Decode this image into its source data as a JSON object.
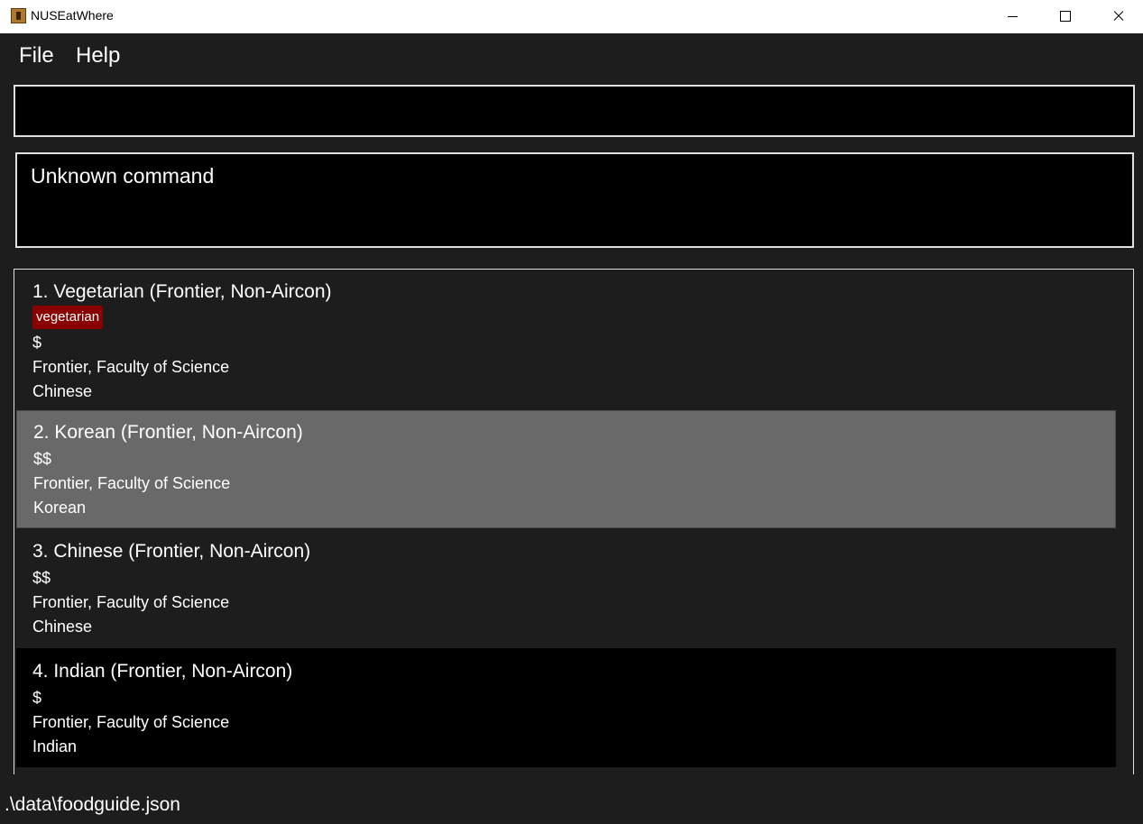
{
  "window": {
    "title": "NUSEatWhere"
  },
  "menu": {
    "file": "File",
    "help": "Help"
  },
  "command": {
    "value": "",
    "placeholder": ""
  },
  "result": {
    "message": "Unknown command"
  },
  "foods": [
    {
      "title": "1.  Vegetarian (Frontier, Non-Aircon)",
      "tag": "vegetarian",
      "price": "$",
      "location": "Frontier, Faculty of Science",
      "cuisine": "Chinese"
    },
    {
      "title": "2.  Korean (Frontier, Non-Aircon)",
      "price": "$$",
      "location": "Frontier, Faculty of Science",
      "cuisine": "Korean"
    },
    {
      "title": "3.  Chinese (Frontier, Non-Aircon)",
      "price": "$$",
      "location": "Frontier, Faculty of Science",
      "cuisine": "Chinese"
    },
    {
      "title": "4.  Indian (Frontier, Non-Aircon)",
      "price": "$",
      "location": "Frontier, Faculty of Science",
      "cuisine": "Indian"
    }
  ],
  "status": {
    "file_path": ".\\data\\foodguide.json"
  },
  "colors": {
    "background": "#1d1d1d",
    "selected_card": "#696969",
    "tag": "#8b0000",
    "border": "#e0e0e0"
  }
}
